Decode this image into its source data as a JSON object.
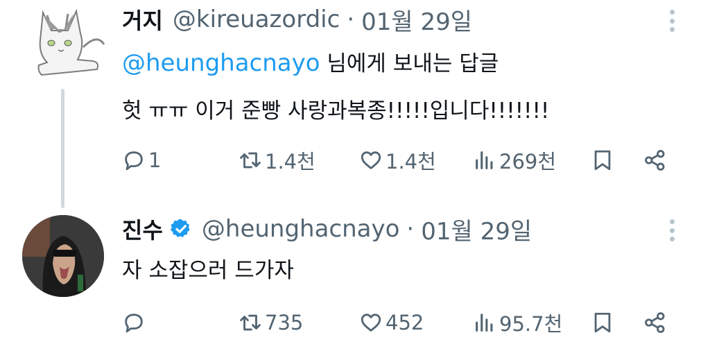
{
  "colors": {
    "accent": "#1d9bf0",
    "secondary_text": "#536471",
    "primary_text": "#0f1419",
    "thread_line": "#cfd9de"
  },
  "tweets": [
    {
      "display_name": "거지",
      "handle": "@kireuazordic",
      "separator": "·",
      "date": "01월 29일",
      "verified": false,
      "reply_to": {
        "mention": "@heunghacnayo",
        "suffix": " 님에게 보내는 답글"
      },
      "text": "헛 ㅠㅠ 이거 준빵 사랑과복종!!!!!입니다!!!!!!!",
      "avatar_icon": "cat-sketch-avatar",
      "stats": {
        "replies": "1",
        "retweets": "1.4천",
        "likes": "1.4천",
        "views": "269천"
      }
    },
    {
      "display_name": "진수",
      "handle": "@heunghacnayo",
      "separator": "·",
      "date": "01월 29일",
      "verified": true,
      "text": "자 소잡으러 드가자",
      "avatar_icon": "hooded-figure-avatar",
      "stats": {
        "replies": "",
        "retweets": "735",
        "likes": "452",
        "views": "95.7천"
      }
    }
  ],
  "icons": {
    "reply": "speech-bubble-icon",
    "retweet": "retweet-arrows-icon",
    "like": "heart-icon",
    "views": "bar-chart-icon",
    "bookmark": "bookmark-icon",
    "share": "share-nodes-icon",
    "more": "vertical-dots-icon",
    "verified": "verified-badge-icon"
  }
}
